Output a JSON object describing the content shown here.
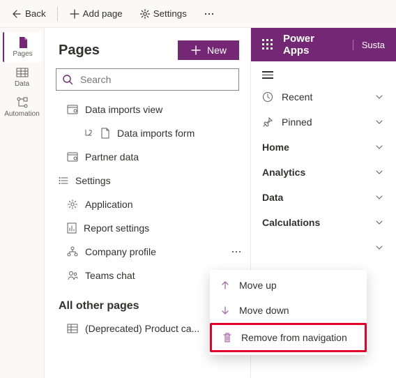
{
  "cmdbar": {
    "back": "Back",
    "add_page": "Add page",
    "settings": "Settings"
  },
  "rail": {
    "pages": "Pages",
    "data": "Data",
    "automation": "Automation"
  },
  "panel": {
    "title": "Pages",
    "new_label": "New",
    "search_placeholder": "Search",
    "tree": {
      "data_imports_view": "Data imports view",
      "data_imports_form": "Data imports form",
      "partner_data": "Partner data",
      "settings": "Settings",
      "application": "Application",
      "report_settings": "Report settings",
      "company_profile": "Company profile",
      "teams_chat": "Teams chat"
    },
    "other_group": "All other pages",
    "other_item": "(Deprecated) Product ca..."
  },
  "preview": {
    "app_title": "Power Apps",
    "app_extra": "Susta",
    "nav": {
      "recent": "Recent",
      "pinned": "Pinned",
      "home": "Home",
      "analytics": "Analytics",
      "data": "Data",
      "calculations": "Calculations"
    }
  },
  "ctx": {
    "move_up": "Move up",
    "move_down": "Move down",
    "remove": "Remove from navigation"
  }
}
